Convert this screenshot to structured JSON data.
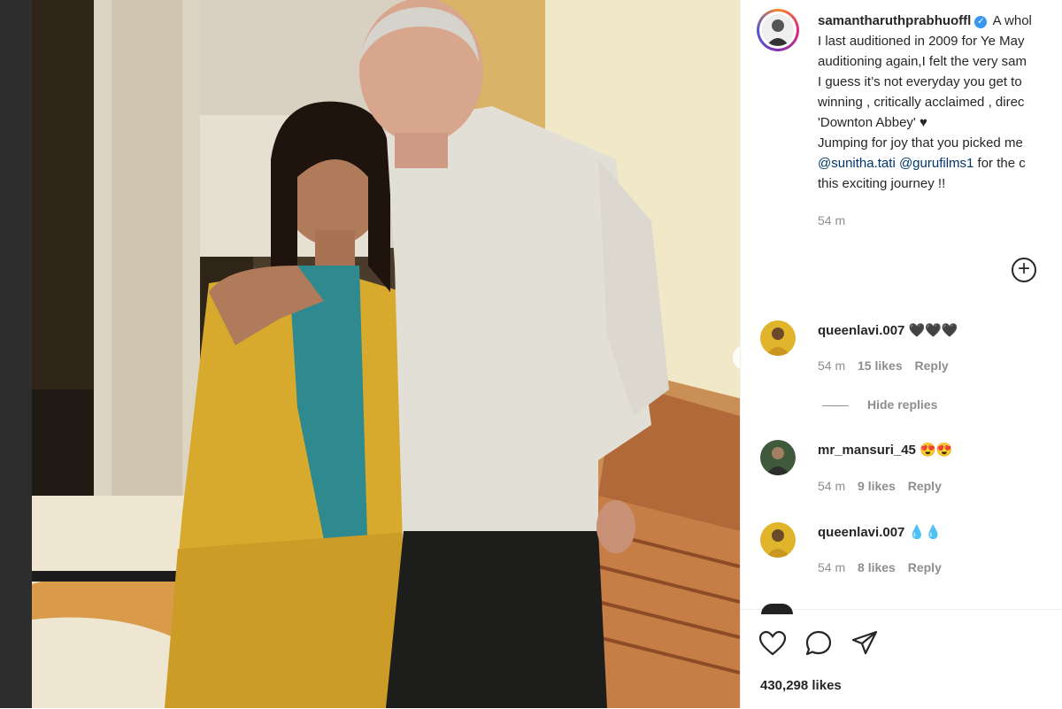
{
  "post": {
    "username": "samantharuthprabhuoffl",
    "caption_lines": [
      " A whol",
      "I last auditioned in 2009 for Ye May",
      "auditioning again,I felt the very sam",
      "I guess it’s not everyday you get to",
      "winning , critically acclaimed , direc",
      "'Downton Abbey' ♥",
      "Jumping for joy that you picked me",
      "@sunitha.tati",
      "@gurufilms1",
      " for the c",
      "this exciting journey !!"
    ],
    "time": "54 m"
  },
  "comments": [
    {
      "user": "queenlavi.007",
      "text": "🖤🖤🖤",
      "time": "54 m",
      "likes": "15 likes",
      "reply": "Reply"
    },
    {
      "user": "mr_mansuri_45",
      "text": "😍😍",
      "time": "54 m",
      "likes": "9 likes",
      "reply": "Reply"
    },
    {
      "user": "queenlavi.007",
      "text": "💧💧",
      "time": "54 m",
      "likes": "8 likes",
      "reply": "Reply"
    }
  ],
  "hide_replies": "Hide replies",
  "likes_count": "430,298 likes",
  "icons": {
    "like": "heart-icon",
    "comment": "comment-icon",
    "share": "share-icon",
    "more_comments": "plus-circle-icon",
    "next": "chevron-right-icon"
  },
  "colors": {
    "verified": "#3897f0",
    "mention": "#00376b",
    "muted": "#8e8e8e"
  }
}
